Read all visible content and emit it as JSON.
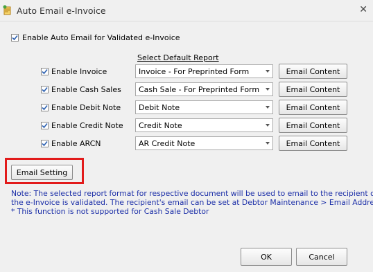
{
  "window": {
    "title": "Auto Email e-Invoice"
  },
  "enable_auto": {
    "label": "Enable Auto Email for Validated e-Invoice",
    "checked": true
  },
  "select_header": "Select Default Report",
  "rows": [
    {
      "label": "Enable Invoice",
      "checked": true,
      "report": "Invoice - For Preprinted Form",
      "button": "Email Content"
    },
    {
      "label": "Enable Cash Sales",
      "checked": true,
      "report": "Cash Sale - For Preprinted Form",
      "button": "Email Content"
    },
    {
      "label": "Enable Debit Note",
      "checked": true,
      "report": "Debit Note",
      "button": "Email Content"
    },
    {
      "label": "Enable Credit Note",
      "checked": true,
      "report": "Credit Note",
      "button": "Email Content"
    },
    {
      "label": "Enable ARCN",
      "checked": true,
      "report": "AR Credit Note",
      "button": "Email Content"
    }
  ],
  "email_setting": "Email Setting",
  "note": {
    "line1": "Note: The selected report format for respective document will be used to email to the recipient once",
    "line2": "the e-Invoice is validated. The recipient's email can be set at Debtor Maintenance > Email Address.",
    "line3": "* This function is not supported for Cash Sale Debtor"
  },
  "buttons": {
    "ok": "OK",
    "cancel": "Cancel"
  },
  "colors": {
    "note_text": "#1c2fa8",
    "highlight_border": "#e21b1b"
  }
}
